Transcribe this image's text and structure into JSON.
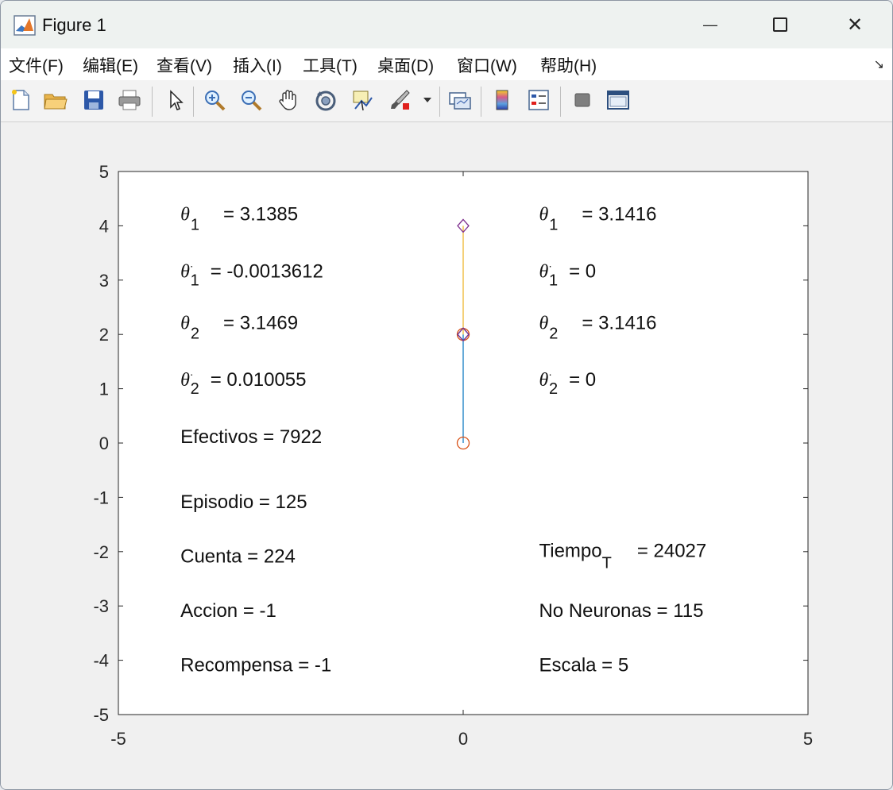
{
  "window": {
    "title": "Figure 1",
    "minimize_glyph": "—",
    "close_glyph": "✕"
  },
  "menu": [
    {
      "label": "文件(F)"
    },
    {
      "label": "编辑(E)"
    },
    {
      "label": "查看(V)"
    },
    {
      "label": "插入(I)"
    },
    {
      "label": "工具(T)"
    },
    {
      "label": "桌面(D)"
    },
    {
      "label": "窗口(W)"
    },
    {
      "label": "帮助(H)"
    }
  ],
  "toolbar_icons": [
    "new-figure-icon",
    "open-folder-icon",
    "save-icon",
    "print-icon",
    "pointer-icon",
    "zoom-in-icon",
    "zoom-out-icon",
    "pan-hand-icon",
    "rotate-3d-icon",
    "data-cursor-icon",
    "brush-icon",
    "brush-dropdown-icon",
    "link-plot-icon",
    "colorbar-icon",
    "legend-icon",
    "hide-plot-tools-icon",
    "show-plot-tools-icon"
  ],
  "chart_data": {
    "type": "line",
    "xlim": [
      -5,
      5
    ],
    "ylim": [
      -5,
      5
    ],
    "x_ticks": [
      -5,
      0,
      5
    ],
    "x_tick_labels": [
      "-5",
      "0",
      "5"
    ],
    "y_ticks": [
      5,
      4,
      3,
      2,
      1,
      0,
      -1,
      -2,
      -3,
      -4,
      -5
    ],
    "y_tick_labels": [
      "5",
      "4",
      "3",
      "2",
      "1",
      "0",
      "-1",
      "-2",
      "-3",
      "-4",
      "-5"
    ],
    "grid": false,
    "series": [
      {
        "points": [
          [
            0,
            0
          ],
          [
            0,
            2
          ]
        ],
        "color": "#0072bd"
      },
      {
        "points": [
          [
            0,
            2
          ],
          [
            0,
            4
          ]
        ],
        "color": "#edb120"
      }
    ],
    "markers": [
      {
        "x": 0,
        "y": 0,
        "shape": "circle",
        "color": "#d95319"
      },
      {
        "x": 0,
        "y": 2,
        "shape": "circle",
        "color": "#d95319"
      },
      {
        "x": 0,
        "y": 2,
        "shape": "diamond",
        "color": "#0072bd"
      },
      {
        "x": 0,
        "y": 2,
        "shape": "diamond",
        "color": "#7e2f8e"
      },
      {
        "x": 0,
        "y": 4,
        "shape": "diamond",
        "color": "#7e2f8e"
      }
    ],
    "annotations": [
      {
        "x": -4.1,
        "y": 4.1,
        "sym": "θ",
        "sub": "1",
        "dot": false,
        "label": "",
        "value": "= 3.1385"
      },
      {
        "x": -4.1,
        "y": 3.05,
        "sym": "θ",
        "sub": "1",
        "dot": true,
        "label": "",
        "value": "= -0.0013612"
      },
      {
        "x": -4.1,
        "y": 2.1,
        "sym": "θ",
        "sub": "2",
        "dot": false,
        "label": "",
        "value": "= 3.1469"
      },
      {
        "x": -4.1,
        "y": 1.05,
        "sym": "θ",
        "sub": "2",
        "dot": true,
        "label": "",
        "value": "= 0.010055"
      },
      {
        "x": -4.1,
        "y": 0.0,
        "sym": "",
        "sub": "",
        "dot": false,
        "label": "Efectivos",
        "value": "= 7922"
      },
      {
        "x": -4.1,
        "y": -1.2,
        "sym": "",
        "sub": "",
        "dot": false,
        "label": "Episodio",
        "value": "= 125"
      },
      {
        "x": -4.1,
        "y": -2.2,
        "sym": "",
        "sub": "",
        "dot": false,
        "label": "Cuenta",
        "value": "= 224"
      },
      {
        "x": -4.1,
        "y": -3.2,
        "sym": "",
        "sub": "",
        "dot": false,
        "label": "Accion",
        "value": "= -1"
      },
      {
        "x": -4.1,
        "y": -4.2,
        "sym": "",
        "sub": "",
        "dot": false,
        "label": "Recompensa",
        "value": "= -1"
      },
      {
        "x": 1.1,
        "y": 4.1,
        "sym": "θ",
        "sub": "1",
        "dot": false,
        "label": "",
        "value": "= 3.1416"
      },
      {
        "x": 1.1,
        "y": 3.05,
        "sym": "θ",
        "sub": "1",
        "dot": true,
        "label": "",
        "value": "= 0"
      },
      {
        "x": 1.1,
        "y": 2.1,
        "sym": "θ",
        "sub": "2",
        "dot": false,
        "label": "",
        "value": "= 3.1416"
      },
      {
        "x": 1.1,
        "y": 1.05,
        "sym": "θ",
        "sub": "2",
        "dot": true,
        "label": "",
        "value": "= 0"
      },
      {
        "x": 1.1,
        "y": -2.1,
        "sym": "",
        "sub": "T",
        "dot": false,
        "label": "Tiempo",
        "value": "= 24027"
      },
      {
        "x": 1.1,
        "y": -3.2,
        "sym": "",
        "sub": "",
        "dot": false,
        "label": "No Neuronas",
        "value": "= 115"
      },
      {
        "x": 1.1,
        "y": -4.2,
        "sym": "",
        "sub": "",
        "dot": false,
        "label": "Escala",
        "value": "= 5"
      }
    ]
  }
}
